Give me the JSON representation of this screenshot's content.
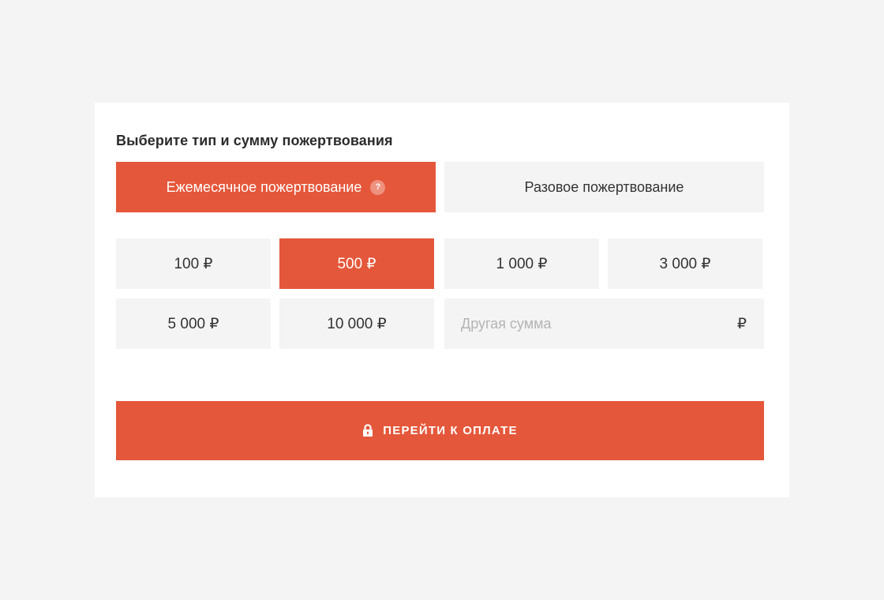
{
  "form": {
    "title": "Выберите тип и сумму пожертвования",
    "types": [
      {
        "label": "Ежемесячное пожертвование",
        "active": true,
        "help_icon": "question-icon",
        "help_glyph": "?"
      },
      {
        "label": "Разовое пожертвование",
        "active": false
      }
    ],
    "amounts": [
      {
        "label": "100 ₽",
        "active": false
      },
      {
        "label": "500 ₽",
        "active": true
      },
      {
        "label": "1 000 ₽",
        "active": false
      },
      {
        "label": "3 000 ₽",
        "active": false
      },
      {
        "label": "5 000 ₽",
        "active": false
      },
      {
        "label": "10 000 ₽",
        "active": false
      }
    ],
    "other_amount": {
      "placeholder": "Другая сумма",
      "value": "",
      "currency": "₽"
    },
    "pay_button": {
      "label": "ПЕРЕЙТИ К ОПЛАТЕ",
      "icon": "lock-icon"
    }
  },
  "colors": {
    "accent": "#e5573a",
    "tile_bg": "#f4f4f4",
    "page_bg": "#f4f4f4",
    "card_bg": "#ffffff",
    "text": "#333333"
  }
}
